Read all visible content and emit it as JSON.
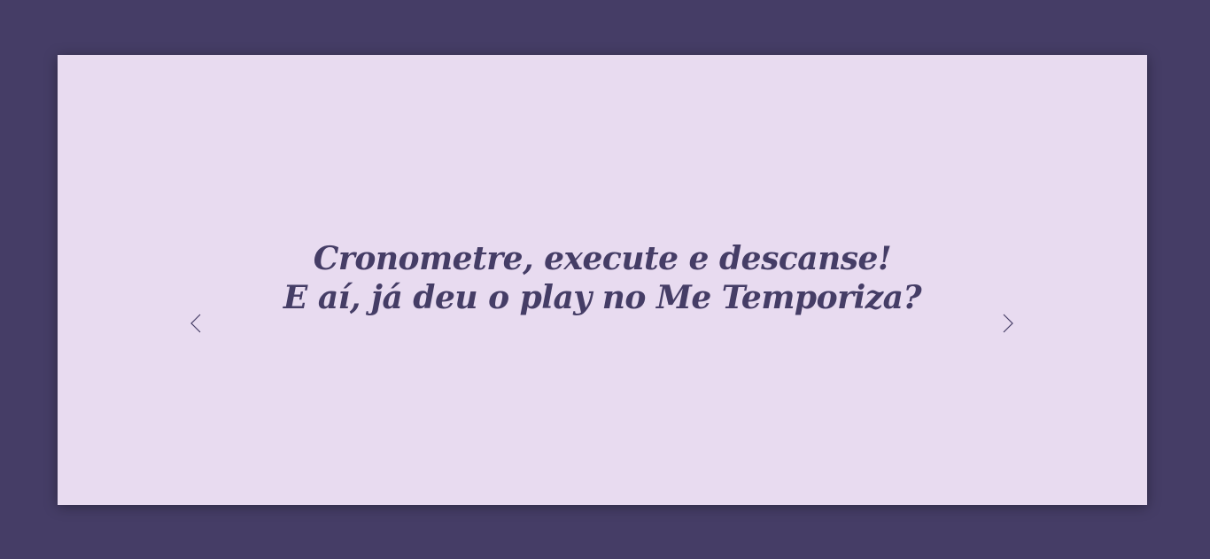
{
  "colors": {
    "background": "#453d66",
    "card": "#e8dbf0",
    "text": "#453d66"
  },
  "carousel": {
    "prev_icon": "chevron-left-icon",
    "next_icon": "chevron-right-icon",
    "slide": {
      "line1": "Cronometre, execute e descanse!",
      "line2": "E aí, já deu o play no Me Temporiza?"
    }
  }
}
